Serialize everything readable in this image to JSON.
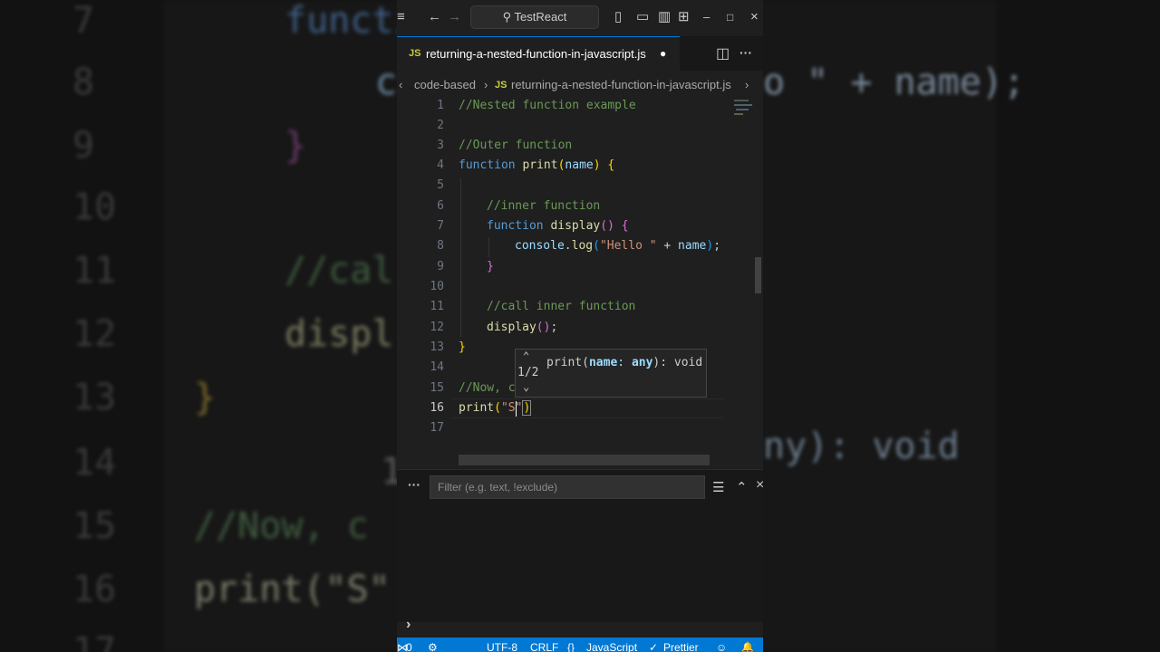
{
  "background": {
    "line_numbers": [
      "7",
      "8",
      "9",
      "10",
      "11",
      "12",
      "13",
      "14",
      "15",
      "16",
      "17"
    ],
    "fragments": {
      "functi": "functi",
      "c": "c",
      "brace_close_pink": "}",
      "cal": "//cal",
      "displ": "displ",
      "brace_close_yellow": "}",
      "one": "1",
      "now_c": "//Now, c",
      "print_s": "print(\"S\"",
      "name_right": "o \" + name);",
      "any_void": "ny): void"
    }
  },
  "titlebar": {
    "menu_icon": "≡",
    "back_icon": "←",
    "forward_icon": "→",
    "search_icon": "⚲",
    "search_label": "TestReact",
    "layout_icons": [
      "▯",
      "▭",
      "▥",
      "⊞"
    ],
    "minimize": "–",
    "maximize": "□",
    "close": "×"
  },
  "tab": {
    "lang_badge": "JS",
    "filename": "returning-a-nested-function-in-javascript.js",
    "modified_dot": "●",
    "split_icon": "◫",
    "more_icon": "···"
  },
  "breadcrumb": {
    "prefix": "‹",
    "folder": "code-based",
    "sep": "›",
    "lang_badge": "JS",
    "file": "returning-a-nested-function-in-javascript.js",
    "sep2": "›"
  },
  "editor": {
    "line_numbers": [
      "1",
      "2",
      "3",
      "4",
      "5",
      "6",
      "7",
      "8",
      "9",
      "10",
      "11",
      "12",
      "13",
      "14",
      "15",
      "16",
      "17"
    ],
    "code": {
      "l1": "//Nested function example",
      "l3": "//Outer function",
      "l4_kw": "function",
      "l4_fn": "print",
      "l4_open": "(",
      "l4_param": "name",
      "l4_close": ")",
      "l4_brace": "{",
      "l6": "//inner function",
      "l7_kw": "function",
      "l7_fn": "display",
      "l7_parens": "()",
      "l7_brace": "{",
      "l8_obj": "console",
      "l8_dot": ".",
      "l8_fn": "log",
      "l8_open": "(",
      "l8_str": "\"Hello \"",
      "l8_plus": " + ",
      "l8_var": "name",
      "l8_close": ")",
      "l8_semi": ";",
      "l9": "}",
      "l11": "//call inner function",
      "l12_fn": "display",
      "l12_parens": "()",
      "l12_semi": ";",
      "l13": "}",
      "l15": "//Now, c",
      "l16_fn": "print",
      "l16_open": "(",
      "l16_str": "\"S\"",
      "l16_close": ")"
    }
  },
  "parameter_hint": {
    "up_icon": "⌃",
    "counter": "1/2",
    "down_icon": "⌄",
    "sig_fn": "print(",
    "sig_param": "name",
    "sig_colon": ": ",
    "sig_type": "any",
    "sig_rest": "): void"
  },
  "panel": {
    "more_icon": "···",
    "filter_placeholder": "Filter (e.g. text, !exclude)",
    "list_icon": "☰",
    "collapse_icon": "⌃",
    "close_icon": "×",
    "prompt": "›"
  },
  "statusbar": {
    "remote_icon": "⋈",
    "errors": "0",
    "debug_icon": "⚙",
    "encoding": "UTF-8",
    "eol": "CRLF",
    "lang_icon": "{}",
    "language": "JavaScript",
    "prettier_check": "✓",
    "prettier": "Prettier",
    "feedback_icon": "☺",
    "bell_icon": "🔔"
  },
  "colors": {
    "accent": "#0078d4",
    "comment": "#6a9955",
    "keyword": "#569cd6",
    "function": "#dcdcaa",
    "param": "#9cdcfe",
    "string": "#ce9178"
  }
}
